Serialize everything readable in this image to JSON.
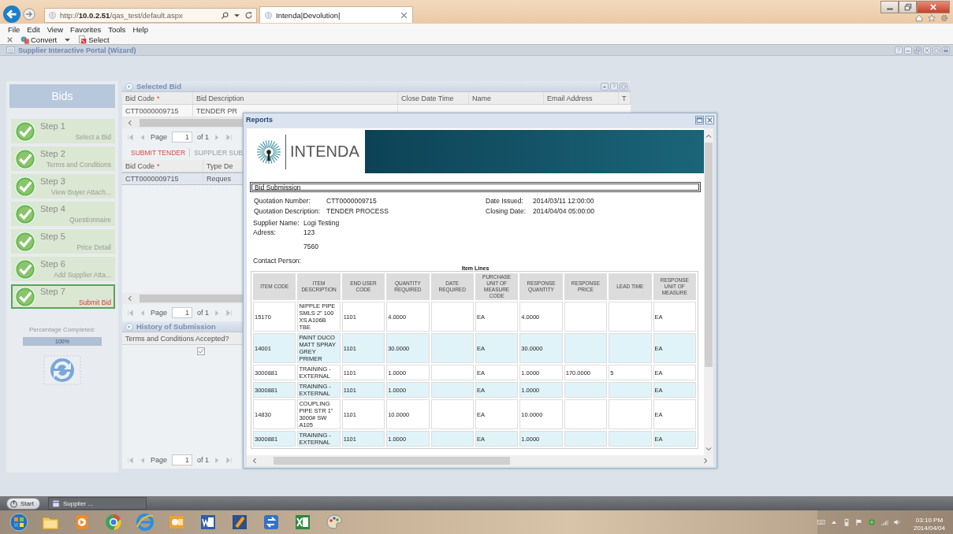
{
  "browser": {
    "address": "http://**10.0.2.51**/qas_test/default.aspx",
    "tab_title": "Intenda|Devolution|"
  },
  "menu": [
    "File",
    "Edit",
    "View",
    "Favorites",
    "Tools",
    "Help"
  ],
  "command_bar": [
    {
      "kind": "convert",
      "label": "Convert"
    },
    {
      "kind": "select",
      "label": "Select"
    }
  ],
  "app": {
    "title": "Supplier Interactive Portal (Wizard)",
    "tools": [
      {
        "kind": "help",
        "label": "?"
      },
      {
        "kind": "minimize"
      },
      {
        "kind": "restore"
      },
      {
        "kind": "close"
      },
      {
        "kind": "gear"
      },
      {
        "kind": "print"
      }
    ]
  },
  "wizard": {
    "title": "Bids",
    "steps": [
      {
        "title": "Step 1",
        "subtitle": "Select a Bid",
        "done": true,
        "selected": false
      },
      {
        "title": "Step 2",
        "subtitle": "Terms and Conditions",
        "done": true,
        "selected": false
      },
      {
        "title": "Step 3",
        "subtitle": "View Buyer Attach...",
        "done": true,
        "selected": false
      },
      {
        "title": "Step 4",
        "subtitle": "Questionnaire",
        "done": true,
        "selected": false
      },
      {
        "title": "Step 5",
        "subtitle": "Price Detail",
        "done": true,
        "selected": false
      },
      {
        "title": "Step 6",
        "subtitle": "Add Supplier Atta...",
        "done": true,
        "selected": false
      },
      {
        "title": "Step 7",
        "subtitle": "Submit Bid",
        "done": true,
        "selected": true
      }
    ],
    "progress_label": "Percentage Completed:",
    "progress": {
      "level": 1,
      "reading": "100%"
    }
  },
  "selected_bid": {
    "title": "Selected Bid",
    "tools": [
      {
        "kind": "collapse"
      },
      {
        "kind": "help",
        "label": "?"
      },
      {
        "kind": "gear"
      }
    ],
    "columns": [
      {
        "label": "Bid Code",
        "marker": "*"
      },
      {
        "label": "Bid Description"
      },
      {
        "label": "Close Date Time"
      },
      {
        "label": "Name"
      },
      {
        "label": "Email Address"
      },
      {
        "label": "T"
      }
    ],
    "rows": [
      {
        "cells": [
          "CTT0000009715",
          "TENDER PR"
        ],
        "selected": false
      }
    ],
    "pager": {
      "label": "Page",
      "page": "1",
      "total": "of 1"
    }
  },
  "tabs": [
    {
      "label": "SUBMIT TENDER",
      "selected": true
    },
    {
      "label": "SUPPLIER SUB",
      "selected": false
    }
  ],
  "submit_grid": {
    "columns": [
      {
        "label": "Bid Code",
        "marker": "*"
      },
      {
        "label": "Type De"
      }
    ],
    "rows": [
      {
        "cells": [
          "CTT0000009715",
          "Reques"
        ],
        "selected": true
      }
    ],
    "pager": {
      "label": "Page",
      "page": "1",
      "total": "of 1"
    }
  },
  "history": {
    "title": "History of Submission",
    "columns": [
      {
        "label": "Terms and Conditions Accepted?"
      }
    ],
    "rows": [
      {
        "checked": true
      }
    ],
    "pager": {
      "label": "Page",
      "page": "1",
      "total": "of 1"
    }
  },
  "reports": {
    "title": "Reports",
    "logo_text": "INTENDA",
    "heading": "Bid Submission",
    "fields_left": [
      {
        "label": "Quotation Number:",
        "value": "CTT0000009715"
      },
      {
        "label": "Quotation Description:",
        "value": "TENDER PROCESS"
      }
    ],
    "fields_right": [
      {
        "label": "Date Issued:",
        "value": "2014/03/11 12:00:00"
      },
      {
        "label": "Closing Date:",
        "value": "2014/04/04 05:00:00"
      }
    ],
    "supplier": [
      {
        "label": "Supplier Name:",
        "value": "Logi Testing"
      },
      {
        "label": "Adress:",
        "value": "123"
      },
      {
        "value": "7560"
      },
      {
        "label": "Contact Person:"
      }
    ],
    "table": {
      "caption": "Item Lines",
      "columns": [
        "ITEM CODE",
        "ITEM DESCRIPTION",
        "END USER CODE",
        "QUANTITY REQUIRED",
        "DATE REQUIRED",
        "PURCHASE UNIT OF MEASURE CODE",
        "RESPONSE QUANTITY",
        "RESPONSE PRICE",
        "LEAD TIME",
        "RESPONSE UNIT OF MEASURE"
      ],
      "rows": [
        [
          "15170",
          "NIPPLE PIPE SMLS 2\" 100 XS A106B TBE",
          "1101",
          "4.0000",
          "",
          "EA",
          "4.0000",
          "",
          "",
          "EA"
        ],
        [
          "14001",
          "PAINT DUCO MATT SPRAY GREY PRIMER",
          "1101",
          "30.0000",
          "",
          "EA",
          "30.0000",
          "",
          "",
          "EA"
        ],
        [
          "3000881",
          "TRAINING - EXTERNAL",
          "1101",
          "1.0000",
          "",
          "EA",
          "1.0000",
          "170.0000",
          "5",
          "EA"
        ],
        [
          "3000881",
          "TRAINING - EXTERNAL",
          "1101",
          "1.0000",
          "",
          "EA",
          "1.0000",
          "",
          "",
          "EA"
        ],
        [
          "14830",
          "COUPLING PIPE STR 1\" 3000# SW A105",
          "1101",
          "10.0000",
          "",
          "EA",
          "10.0000",
          "",
          "",
          "EA"
        ],
        [
          "3000881",
          "TRAINING - EXTERNAL",
          "1101",
          "1.0000",
          "",
          "EA",
          "1.0000",
          "",
          "",
          "EA"
        ]
      ]
    }
  },
  "app_taskbar": {
    "start": "Start",
    "windows": [
      {
        "label": "Supplier ..."
      }
    ]
  },
  "clock": {
    "time": "03:10 PM",
    "date": "2014/04/04"
  }
}
